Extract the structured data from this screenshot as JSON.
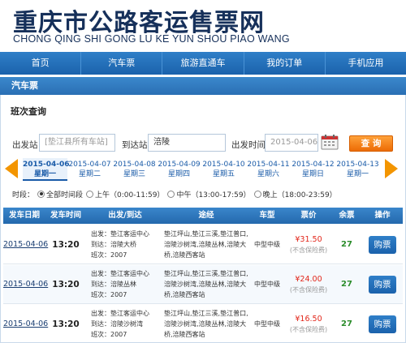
{
  "header": {
    "title": "重庆市公路客运售票网",
    "subtitle": "CHONG QING SHI GONG LU KE YUN SHOU PIAO WANG"
  },
  "nav": {
    "items": [
      {
        "label": "首页"
      },
      {
        "label": "汽车票"
      },
      {
        "label": "旅游直通车"
      },
      {
        "label": "我的订单"
      },
      {
        "label": "手机应用"
      }
    ]
  },
  "section": {
    "title": "汽车票"
  },
  "query": {
    "title": "班次查询",
    "from_label": "出发站",
    "from_value": "[垫江县所有车站]",
    "to_label": "到达站",
    "to_value": "涪陵",
    "date_label": "出发时间",
    "date_value": "2015-04-06",
    "search_label": "查 询"
  },
  "dates": [
    {
      "date": "2015-04-06",
      "weekday": "星期一",
      "active": true
    },
    {
      "date": "2015-04-07",
      "weekday": "星期二"
    },
    {
      "date": "2015-04-08",
      "weekday": "星期三"
    },
    {
      "date": "2015-04-09",
      "weekday": "星期四"
    },
    {
      "date": "2015-04-10",
      "weekday": "星期五"
    },
    {
      "date": "2015-04-11",
      "weekday": "星期六"
    },
    {
      "date": "2015-04-12",
      "weekday": "星期日"
    },
    {
      "date": "2015-04-13",
      "weekday": "星期一"
    }
  ],
  "time_filter": {
    "label": "时段：",
    "options": [
      {
        "label": "全部时间段",
        "selected": true
      },
      {
        "label": "上午（0:00-11:59）"
      },
      {
        "label": "中午（13:00-17:59）"
      },
      {
        "label": "晚上（18:00-23:59）"
      }
    ]
  },
  "table": {
    "headers": [
      "发车日期",
      "发车时间",
      "出发/到达",
      "途经",
      "车型",
      "票价",
      "余票",
      "操作"
    ],
    "rows": [
      {
        "date": "2015-04-06",
        "time": "13:20",
        "depart": "出发：垫江客运中心",
        "arrive": "到达：涪陵大桥",
        "trip": "班次：2007",
        "via": "垫江坪山,垫江三溪,垫江普口,涪陵沙树湾,涪陵丛林,涪陵大桥,涪陵西客站",
        "type": "中型中级",
        "price": "¥31.50",
        "price_note": "(不含保险费)",
        "left": "27",
        "action": "购票"
      },
      {
        "date": "2015-04-06",
        "time": "13:20",
        "depart": "出发：垫江客运中心",
        "arrive": "到达：涪陵丛林",
        "trip": "班次：2007",
        "via": "垫江坪山,垫江三溪,垫江普口,涪陵沙树湾,涪陵丛林,涪陵大桥,涪陵西客站",
        "type": "中型中级",
        "price": "¥24.00",
        "price_note": "(不含保险费)",
        "left": "27",
        "action": "购票"
      },
      {
        "date": "2015-04-06",
        "time": "13:20",
        "depart": "出发：垫江客运中心",
        "arrive": "到达：涪陵沙树湾",
        "trip": "班次：2007",
        "via": "垫江坪山,垫江三溪,垫江普口,涪陵沙树湾,涪陵丛林,涪陵大桥,涪陵西客站",
        "type": "中型中级",
        "price": "¥16.50",
        "price_note": "(不含保险费)",
        "left": "27",
        "action": "购票"
      }
    ]
  },
  "colors": {
    "brand_blue": "#1b62ac",
    "title_navy": "#16305a",
    "accent_orange": "#ec6b05",
    "price_red": "#e2271b",
    "seats_green": "#2a8c2a"
  }
}
